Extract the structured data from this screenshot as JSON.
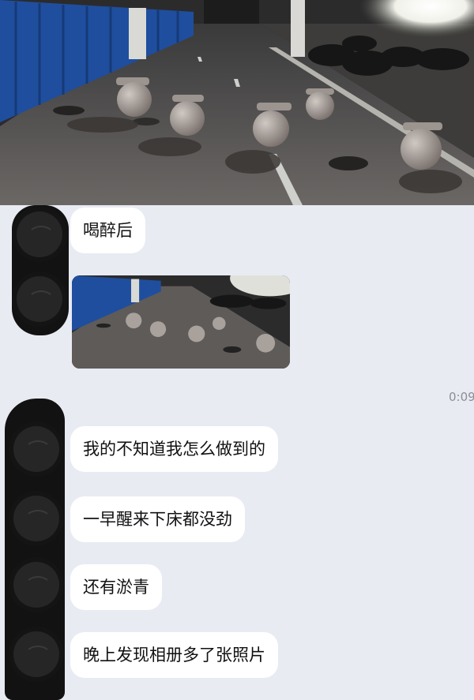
{
  "chat": {
    "timestamp": "0:09",
    "messages": [
      {
        "type": "text",
        "text": "喝醉后"
      },
      {
        "type": "image",
        "image_name": "street-bollards-photo"
      },
      {
        "type": "text",
        "text": "我的不知道我怎么做到的"
      },
      {
        "type": "text",
        "text": "一早醒来下床都没劲"
      },
      {
        "type": "text",
        "text": "还有淤青"
      },
      {
        "type": "text",
        "text": "晚上发现相册多了张照片"
      }
    ]
  },
  "colors": {
    "chat_background": "#e9ebf3",
    "bubble": "#ffffff",
    "censor_mark": "#121212",
    "fence_blue": "#1f4e9e"
  }
}
